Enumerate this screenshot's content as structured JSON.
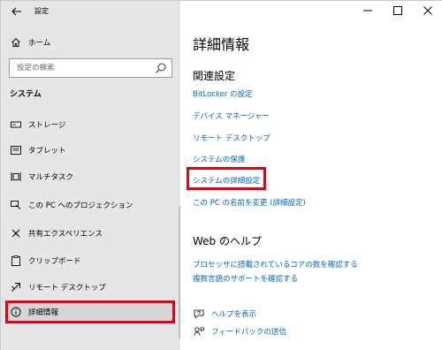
{
  "window": {
    "title": "設定"
  },
  "sidebar": {
    "home_label": "ホーム",
    "search_placeholder": "設定の検索",
    "section_label": "システム",
    "items": [
      {
        "label": "ストレージ",
        "icon": "storage-icon"
      },
      {
        "label": "タブレット",
        "icon": "tablet-icon"
      },
      {
        "label": "マルチタスク",
        "icon": "multitasking-icon"
      },
      {
        "label": "この PC へのプロジェクション",
        "icon": "projection-icon"
      },
      {
        "label": "共有エクスペリエンス",
        "icon": "shared-experience-icon"
      },
      {
        "label": "クリップボード",
        "icon": "clipboard-icon"
      },
      {
        "label": "リモート デスクトップ",
        "icon": "remote-desktop-icon"
      },
      {
        "label": "詳細情報",
        "icon": "info-icon",
        "selected": true
      }
    ]
  },
  "main": {
    "title": "詳細情報",
    "related_settings": {
      "heading": "関連設定",
      "links": [
        "BitLocker の設定",
        "デバイス マネージャー",
        "リモート デスクトップ",
        "システムの保護",
        "システムの詳細設定",
        "この PC の名前を変更 (詳細設定)"
      ]
    },
    "web_help": {
      "heading": "Web のヘルプ",
      "links": [
        "プロセッサに搭載されているコアの数を確認する",
        "複数言語のサポートを確認する"
      ]
    },
    "footer": {
      "get_help": "ヘルプを表示",
      "feedback": "フィードバックの送信"
    }
  },
  "colors": {
    "accent": "#0067c0",
    "highlight": "#e3000f",
    "sidebar_bg": "#e6e6e6"
  }
}
